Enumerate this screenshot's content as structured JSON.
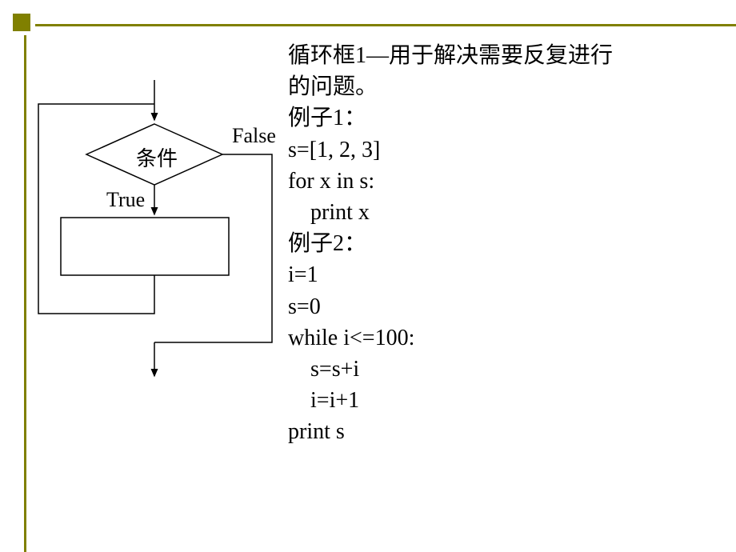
{
  "presentation": {
    "border_color": "#808000"
  },
  "diagram": {
    "condition_label": "条件",
    "true_label": "True",
    "false_label": "False"
  },
  "content": {
    "title_line1": "循环框1—用于解决需要反复进行",
    "title_line2": "的问题。",
    "example1_header": "例子1：",
    "example1_line1": "s=[1, 2, 3]",
    "example1_line2": "for x in s:",
    "example1_line3": "    print x",
    "example2_header": "例子2：",
    "example2_line1": "i=1",
    "example2_line2": "s=0",
    "example2_line3": "while i<=100:",
    "example2_line4": "    s=s+i",
    "example2_line5": "    i=i+1",
    "example2_line6": "print s"
  }
}
